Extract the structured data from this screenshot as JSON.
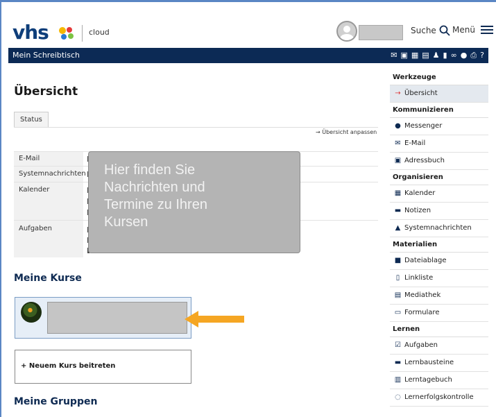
{
  "header": {
    "logo_text": "vhs",
    "logo_suffix": "cloud",
    "search_label": "Suche",
    "menu_label": "Menü"
  },
  "navbar": {
    "title": "Mein Schreibtisch",
    "icons": [
      "mail-icon",
      "message-icon",
      "calendar-icon",
      "notes-icon",
      "user-icon",
      "bookmark-icon",
      "link-icon",
      "location-icon",
      "print-icon",
      "help-icon"
    ]
  },
  "main": {
    "title": "Übersicht",
    "tab": "Status",
    "adjust_link": "Übersicht anpassen",
    "status_rows": [
      "E-Mail",
      "Systemnachrichten",
      "Kalender",
      "Aufgaben"
    ],
    "overlay_text": [
      "Hier finden Sie",
      "Nachrichten und",
      "Termine zu Ihren",
      "Kursen"
    ],
    "courses_heading": "Meine Kurse",
    "join_label": "+ Neuem Kurs beitreten",
    "groups_heading": "Meine Gruppen"
  },
  "sidebar": {
    "sections": [
      {
        "title": "Werkzeuge",
        "items": [
          {
            "label": "Übersicht",
            "icon": "arrow-icon",
            "active": true
          }
        ]
      },
      {
        "title": "Kommunizieren",
        "items": [
          {
            "label": "Messenger",
            "icon": "messenger-icon"
          },
          {
            "label": "E-Mail",
            "icon": "mail-icon"
          },
          {
            "label": "Adressbuch",
            "icon": "addressbook-icon"
          }
        ]
      },
      {
        "title": "Organisieren",
        "items": [
          {
            "label": "Kalender",
            "icon": "calendar-icon"
          },
          {
            "label": "Notizen",
            "icon": "notes-icon"
          },
          {
            "label": "Systemnachrichten",
            "icon": "warning-icon"
          }
        ]
      },
      {
        "title": "Materialien",
        "items": [
          {
            "label": "Dateiablage",
            "icon": "folder-icon"
          },
          {
            "label": "Linkliste",
            "icon": "linklist-icon"
          },
          {
            "label": "Mediathek",
            "icon": "media-icon"
          },
          {
            "label": "Formulare",
            "icon": "form-icon"
          }
        ]
      },
      {
        "title": "Lernen",
        "items": [
          {
            "label": "Aufgaben",
            "icon": "task-icon"
          },
          {
            "label": "Lernbausteine",
            "icon": "module-icon"
          },
          {
            "label": "Lerntagebuch",
            "icon": "diary-icon"
          },
          {
            "label": "Lernerfolgskontrolle",
            "icon": "progress-icon"
          }
        ]
      }
    ]
  },
  "colors": {
    "navy": "#0c2a55",
    "accent": "#f5a623",
    "overlay": "#b4b4b4"
  }
}
